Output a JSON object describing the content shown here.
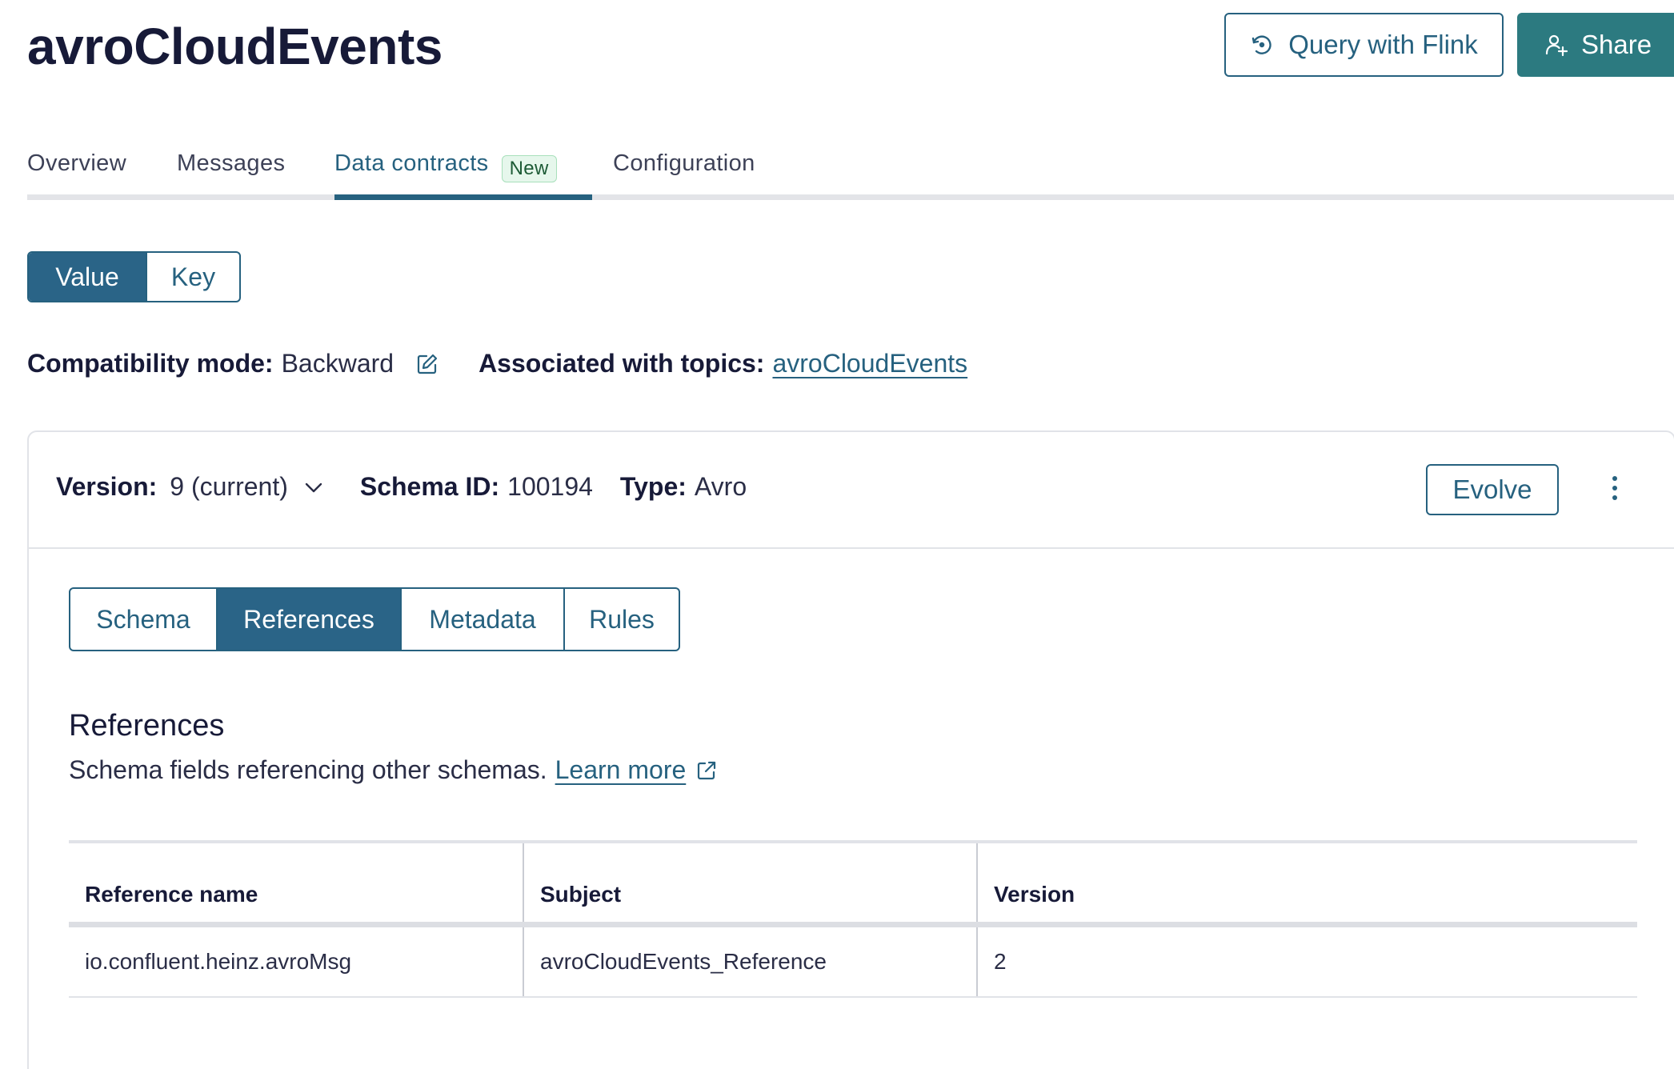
{
  "header": {
    "title": "avroCloudEvents",
    "query_button": "Query with Flink",
    "share_button": "Share"
  },
  "tabs": [
    {
      "label": "Overview"
    },
    {
      "label": "Messages"
    },
    {
      "label": "Data contracts",
      "badge": "New",
      "active": true
    },
    {
      "label": "Configuration"
    }
  ],
  "schema_toggle": {
    "options": [
      "Value",
      "Key"
    ],
    "selected": "Value"
  },
  "compat": {
    "label": "Compatibility mode:",
    "value": "Backward",
    "topics_label": "Associated with topics:",
    "topic_link": "avroCloudEvents"
  },
  "card": {
    "version_label": "Version:",
    "version_value": "9 (current)",
    "schema_id_label": "Schema ID:",
    "schema_id_value": "100194",
    "type_label": "Type:",
    "type_value": "Avro",
    "evolve_button": "Evolve"
  },
  "sub_tabs": {
    "options": [
      "Schema",
      "References",
      "Metadata",
      "Rules"
    ],
    "selected": "References"
  },
  "references": {
    "heading": "References",
    "description": "Schema fields referencing other schemas.",
    "learn_more": "Learn more",
    "columns": [
      "Reference name",
      "Subject",
      "Version"
    ],
    "rows": [
      [
        "io.confluent.heinz.avroMsg",
        "avroCloudEvents_Reference",
        "2"
      ]
    ]
  },
  "colors": {
    "primary": "#26617f",
    "share_bg": "#2c7a80",
    "selected_bg": "#2a6487",
    "badge_bg": "#e6f7ec"
  }
}
